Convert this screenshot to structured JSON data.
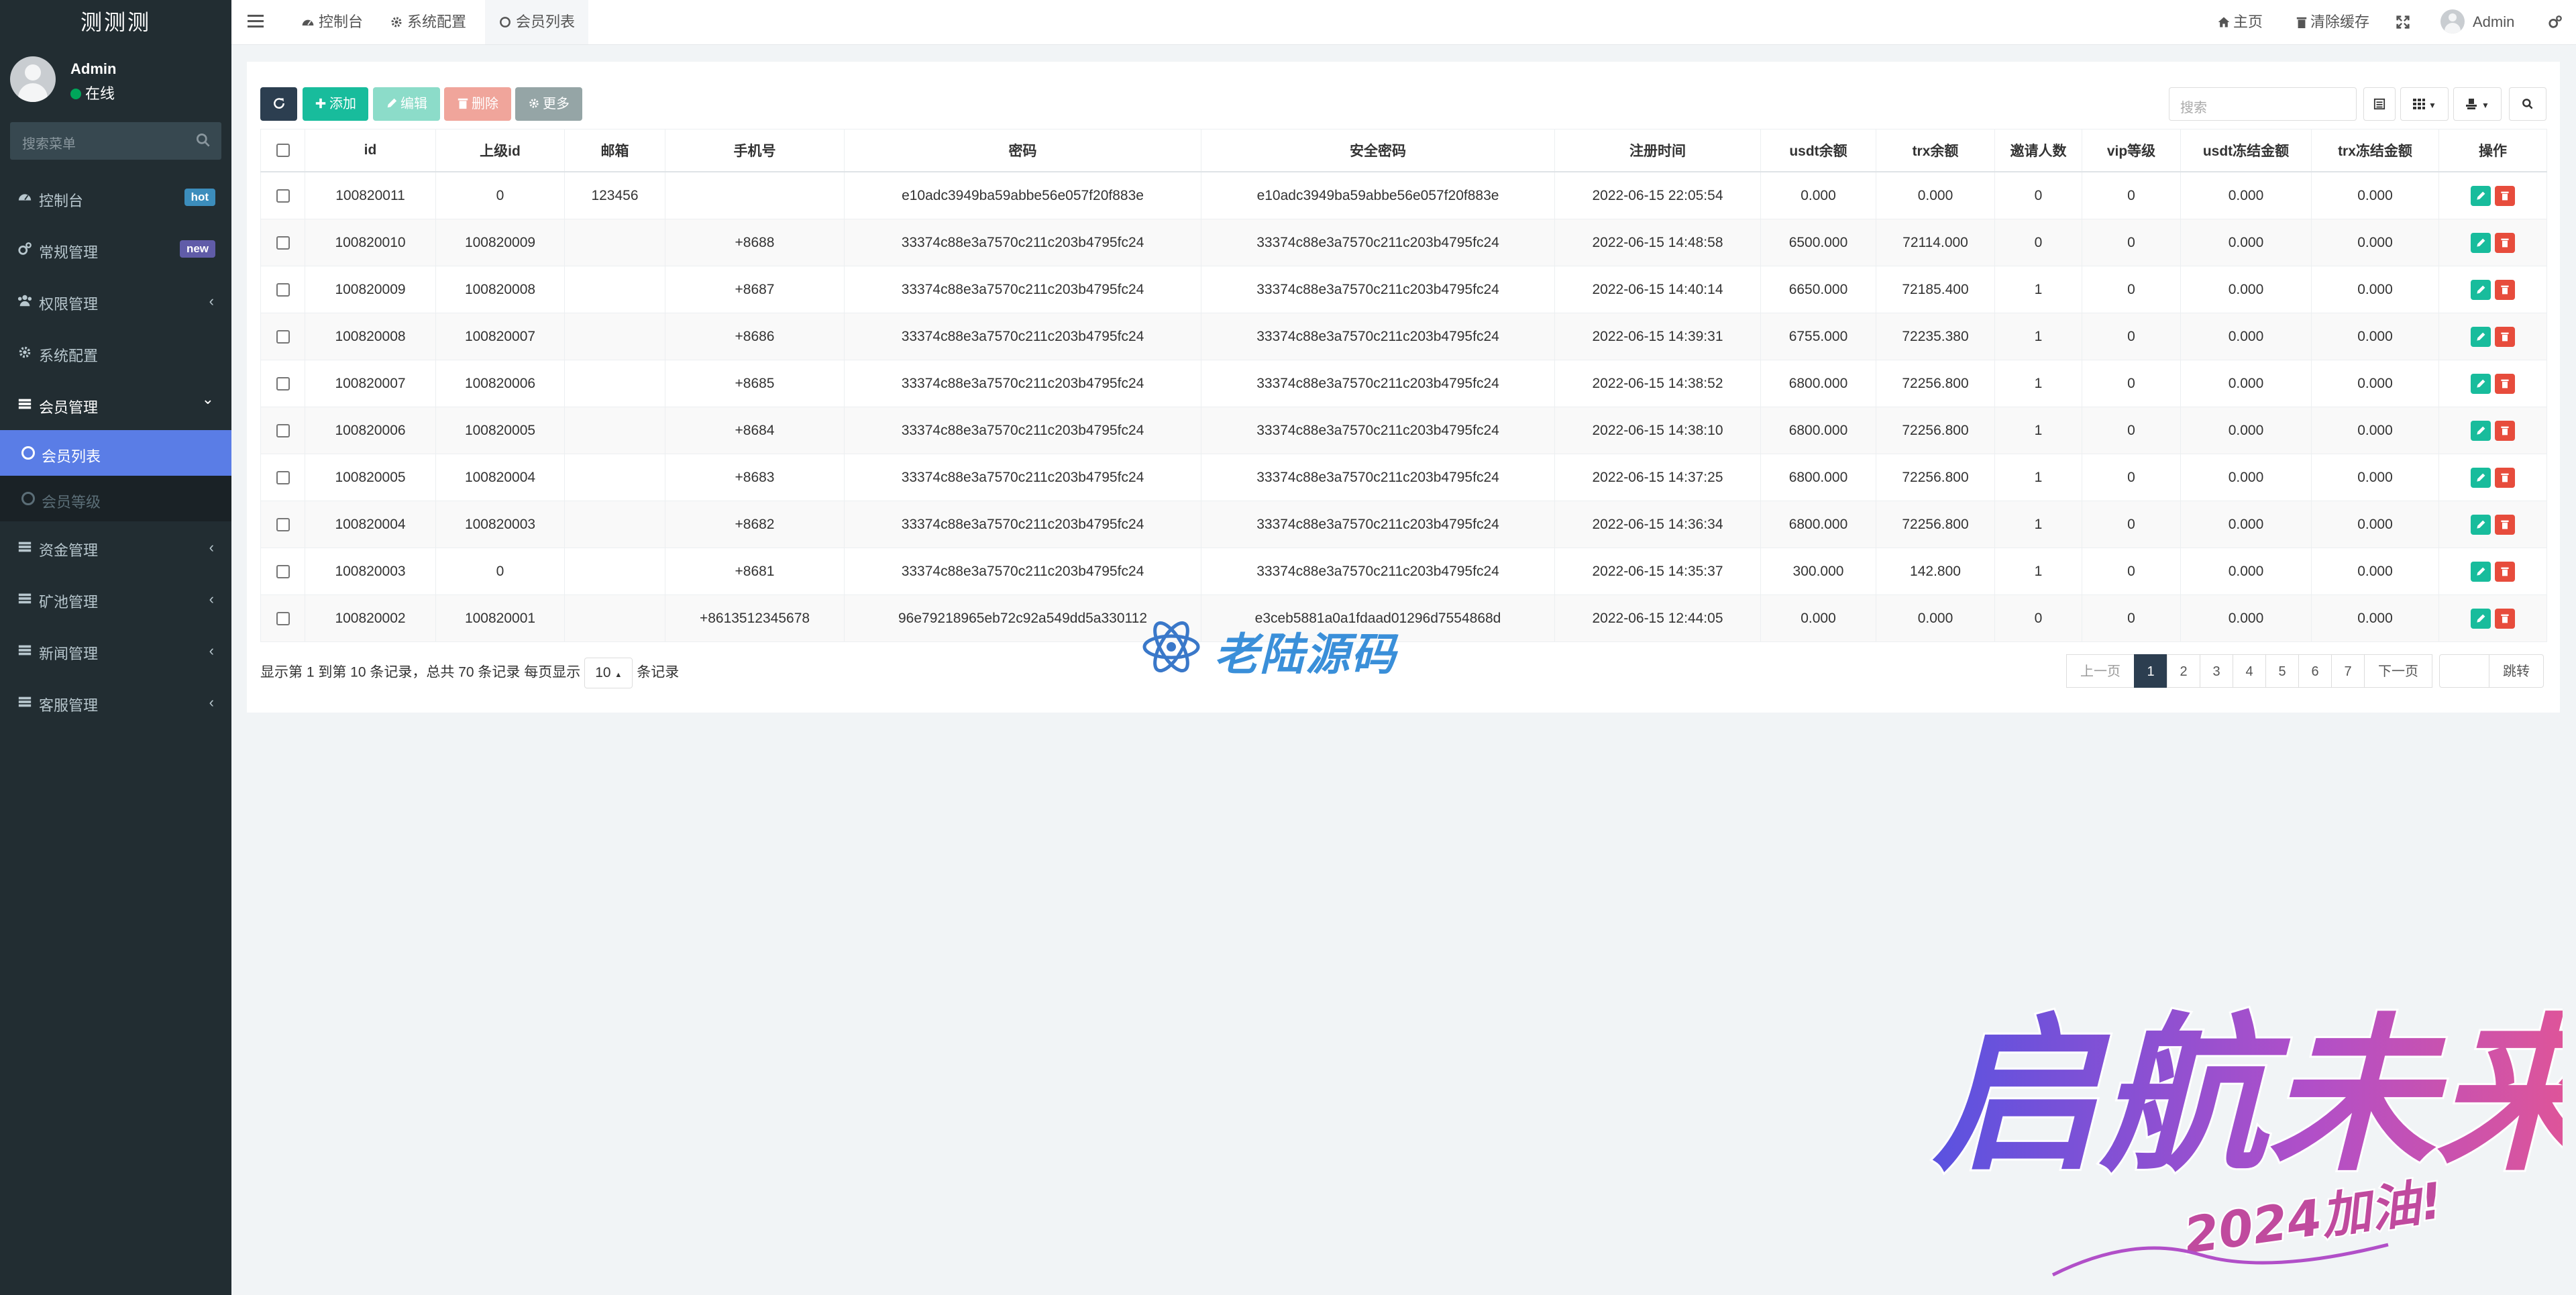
{
  "app": {
    "title": "测测测"
  },
  "user": {
    "name": "Admin",
    "status": "在线"
  },
  "sidebar": {
    "search_placeholder": "搜索菜单",
    "items": [
      {
        "label": "控制台",
        "icon": "dashboard-icon",
        "badge": "hot"
      },
      {
        "label": "常规管理",
        "icon": "cogs-icon",
        "badge": "new"
      },
      {
        "label": "权限管理",
        "icon": "group-icon",
        "chevron": "‹"
      },
      {
        "label": "系统配置",
        "icon": "cog-icon"
      },
      {
        "label": "会员管理",
        "icon": "list-icon",
        "chevron": "⌄"
      },
      {
        "label": "资金管理",
        "icon": "list-icon",
        "chevron": "‹"
      },
      {
        "label": "矿池管理",
        "icon": "list-icon",
        "chevron": "‹"
      },
      {
        "label": "新闻管理",
        "icon": "list-icon",
        "chevron": "‹"
      },
      {
        "label": "客服管理",
        "icon": "list-icon",
        "chevron": "‹"
      }
    ],
    "subitems": [
      {
        "label": "会员列表",
        "active": true
      },
      {
        "label": "会员等级",
        "active": false
      }
    ]
  },
  "topbar": {
    "tabs": [
      {
        "label": "控制台",
        "icon": "dashboard-icon"
      },
      {
        "label": "系统配置",
        "icon": "cog-icon"
      },
      {
        "label": "会员列表",
        "icon": "circle-icon",
        "active": true
      }
    ],
    "home": "主页",
    "clear_cache": "清除缓存",
    "admin": "Admin"
  },
  "toolbar": {
    "add": "添加",
    "edit": "编辑",
    "delete": "删除",
    "more": "更多",
    "search_placeholder": "搜索"
  },
  "table": {
    "columns": [
      "id",
      "上级id",
      "邮箱",
      "手机号",
      "密码",
      "安全密码",
      "注册时间",
      "usdt余额",
      "trx余额",
      "邀请人数",
      "vip等级",
      "usdt冻结金额",
      "trx冻结金额",
      "操作"
    ],
    "rows": [
      [
        "100820011",
        "0",
        "123456",
        "",
        "e10adc3949ba59abbe56e057f20f883e",
        "e10adc3949ba59abbe56e057f20f883e",
        "2022-06-15 22:05:54",
        "0.000",
        "0.000",
        "0",
        "0",
        "0.000",
        "0.000"
      ],
      [
        "100820010",
        "100820009",
        "",
        "+8688",
        "33374c88e3a7570c211c203b4795fc24",
        "33374c88e3a7570c211c203b4795fc24",
        "2022-06-15 14:48:58",
        "6500.000",
        "72114.000",
        "0",
        "0",
        "0.000",
        "0.000"
      ],
      [
        "100820009",
        "100820008",
        "",
        "+8687",
        "33374c88e3a7570c211c203b4795fc24",
        "33374c88e3a7570c211c203b4795fc24",
        "2022-06-15 14:40:14",
        "6650.000",
        "72185.400",
        "1",
        "0",
        "0.000",
        "0.000"
      ],
      [
        "100820008",
        "100820007",
        "",
        "+8686",
        "33374c88e3a7570c211c203b4795fc24",
        "33374c88e3a7570c211c203b4795fc24",
        "2022-06-15 14:39:31",
        "6755.000",
        "72235.380",
        "1",
        "0",
        "0.000",
        "0.000"
      ],
      [
        "100820007",
        "100820006",
        "",
        "+8685",
        "33374c88e3a7570c211c203b4795fc24",
        "33374c88e3a7570c211c203b4795fc24",
        "2022-06-15 14:38:52",
        "6800.000",
        "72256.800",
        "1",
        "0",
        "0.000",
        "0.000"
      ],
      [
        "100820006",
        "100820005",
        "",
        "+8684",
        "33374c88e3a7570c211c203b4795fc24",
        "33374c88e3a7570c211c203b4795fc24",
        "2022-06-15 14:38:10",
        "6800.000",
        "72256.800",
        "1",
        "0",
        "0.000",
        "0.000"
      ],
      [
        "100820005",
        "100820004",
        "",
        "+8683",
        "33374c88e3a7570c211c203b4795fc24",
        "33374c88e3a7570c211c203b4795fc24",
        "2022-06-15 14:37:25",
        "6800.000",
        "72256.800",
        "1",
        "0",
        "0.000",
        "0.000"
      ],
      [
        "100820004",
        "100820003",
        "",
        "+8682",
        "33374c88e3a7570c211c203b4795fc24",
        "33374c88e3a7570c211c203b4795fc24",
        "2022-06-15 14:36:34",
        "6800.000",
        "72256.800",
        "1",
        "0",
        "0.000",
        "0.000"
      ],
      [
        "100820003",
        "0",
        "",
        "+8681",
        "33374c88e3a7570c211c203b4795fc24",
        "33374c88e3a7570c211c203b4795fc24",
        "2022-06-15 14:35:37",
        "300.000",
        "142.800",
        "1",
        "0",
        "0.000",
        "0.000"
      ],
      [
        "100820002",
        "100820001",
        "",
        "+8613512345678",
        "96e79218965eb72c92a549dd5a330112",
        "e3ceb5881a0a1fdaad01296d7554868d",
        "2022-06-15 12:44:05",
        "0.000",
        "0.000",
        "0",
        "0",
        "0.000",
        "0.000"
      ]
    ]
  },
  "footer": {
    "info_prefix": "显示第 1 到第 10 条记录，总共 70 条记录 每页显示",
    "page_size": "10",
    "info_suffix": "条记录"
  },
  "pagination": {
    "prev": "上一页",
    "pages": [
      "1",
      "2",
      "3",
      "4",
      "5",
      "6",
      "7"
    ],
    "current": "1",
    "next": "下一页",
    "jump": "跳转"
  },
  "watermarks": {
    "center": "老陆源码",
    "corner_main": "启航未来",
    "corner_sub": "2024加油!"
  },
  "colors": {
    "sidebar_bg": "#222d32",
    "active_menu": "#5a7de6",
    "add": "#18bc9c",
    "delete": "#e74c3c",
    "pager_active": "#2c3e50"
  }
}
